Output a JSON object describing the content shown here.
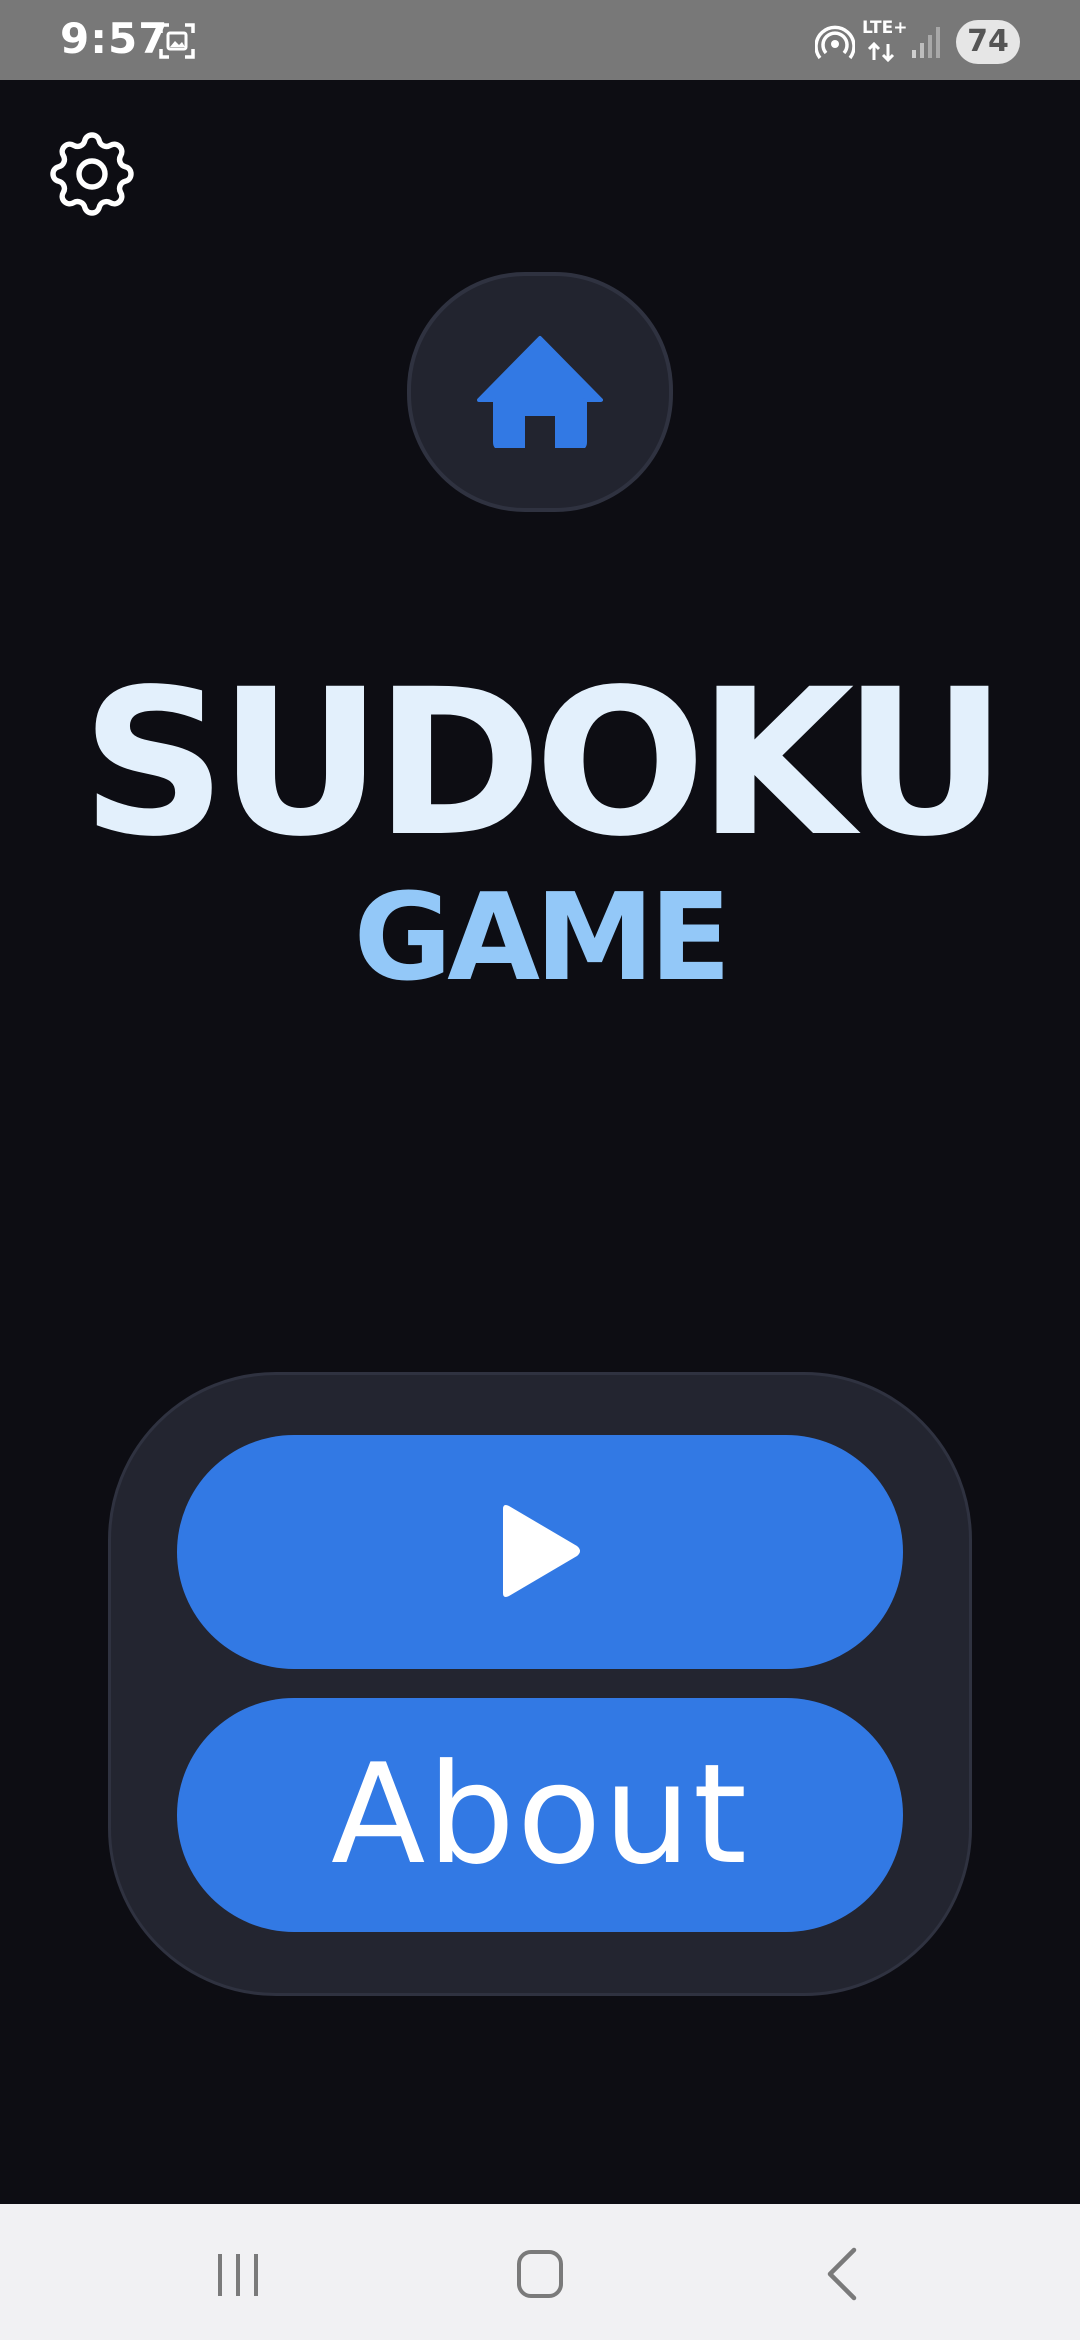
{
  "status_bar": {
    "time": "9:57",
    "network": "LTE+",
    "battery": "74",
    "icons": [
      "screenshot-icon",
      "hotspot-icon",
      "lte-icon",
      "signal-icon",
      "battery-icon"
    ]
  },
  "header": {
    "settings_icon": "gear-icon",
    "home_icon": "home-icon"
  },
  "title": {
    "main": "SUDOKU",
    "sub": "GAME"
  },
  "menu": {
    "play_icon": "play-icon",
    "about_label": "About"
  },
  "nav_bar": {
    "icons": [
      "recent-apps-icon",
      "home-nav-icon",
      "back-icon"
    ]
  },
  "colors": {
    "background": "#0d0d13",
    "panel": "#232530",
    "accent": "#3279e4",
    "title": "#e3f0fc",
    "subtitle": "#93c8f8"
  }
}
